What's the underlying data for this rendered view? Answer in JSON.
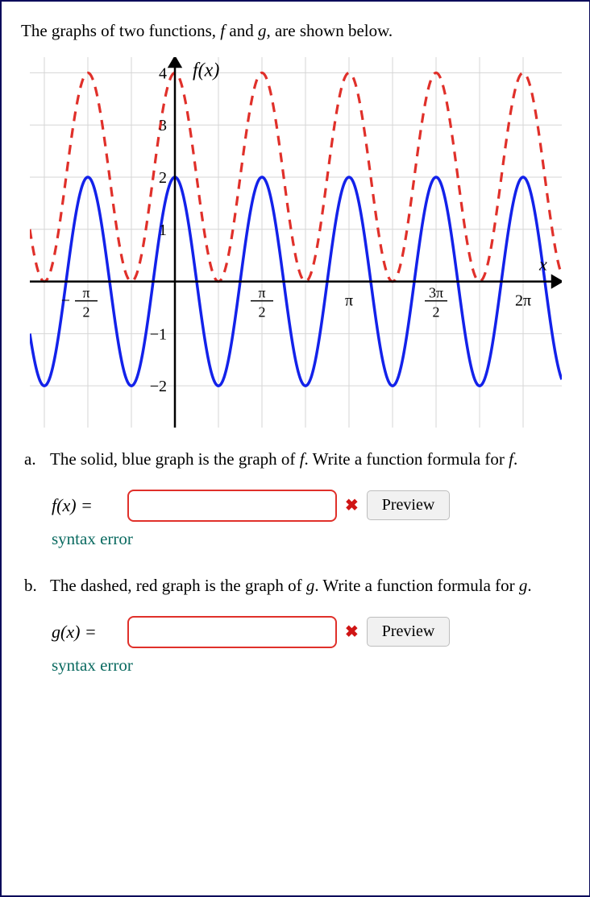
{
  "prompt": {
    "pre": "The graphs of two functions, ",
    "f": "f",
    "between": " and ",
    "g": "g",
    "post": ", are shown below."
  },
  "chart_data": {
    "type": "line",
    "xlabel": "x",
    "fn_label": "f(x)",
    "xlim": [
      -2.618,
      6.981
    ],
    "ylim": [
      -2.8,
      4.3
    ],
    "x_ticks": [
      {
        "value": -1.5708,
        "label_type": "frac",
        "sign": "−",
        "num": "π",
        "den": "2"
      },
      {
        "value": 1.5708,
        "label_type": "frac",
        "sign": "",
        "num": "π",
        "den": "2"
      },
      {
        "value": 3.1416,
        "label_type": "plain",
        "label": "π"
      },
      {
        "value": 4.7124,
        "label_type": "frac",
        "sign": "",
        "num": "3π",
        "den": "2"
      },
      {
        "value": 6.2832,
        "label_type": "plain",
        "label": "2π"
      }
    ],
    "y_ticks": [
      -2,
      -1,
      1,
      2,
      3,
      4
    ],
    "series": [
      {
        "name": "f",
        "style": "solid-blue",
        "formula": "2*cos(4*x)",
        "amplitude": 2,
        "vertical_shift": 0,
        "angular_freq": 4,
        "phase": 0,
        "period": 1.5708
      },
      {
        "name": "g",
        "style": "dashed-red",
        "formula": "2*cos(4*x)+2",
        "amplitude": 2,
        "vertical_shift": 2,
        "angular_freq": 4,
        "phase": 0,
        "period": 1.5708
      }
    ]
  },
  "parts": {
    "a": {
      "marker": "a.",
      "text_pre": "The solid, blue graph is the graph of ",
      "fn": "f",
      "text_mid": ". Write a function formula for ",
      "fn2": "f",
      "text_post": ".",
      "lhs": "f(x) =",
      "value": "",
      "preview": "Preview",
      "error": "syntax error"
    },
    "b": {
      "marker": "b.",
      "text_pre": "The dashed, red graph is the graph of ",
      "fn": "g",
      "text_mid": ". Write a function formula for ",
      "fn2": "g",
      "text_post": ".",
      "lhs": "g(x) =",
      "value": "",
      "preview": "Preview",
      "error": "syntax error"
    }
  }
}
